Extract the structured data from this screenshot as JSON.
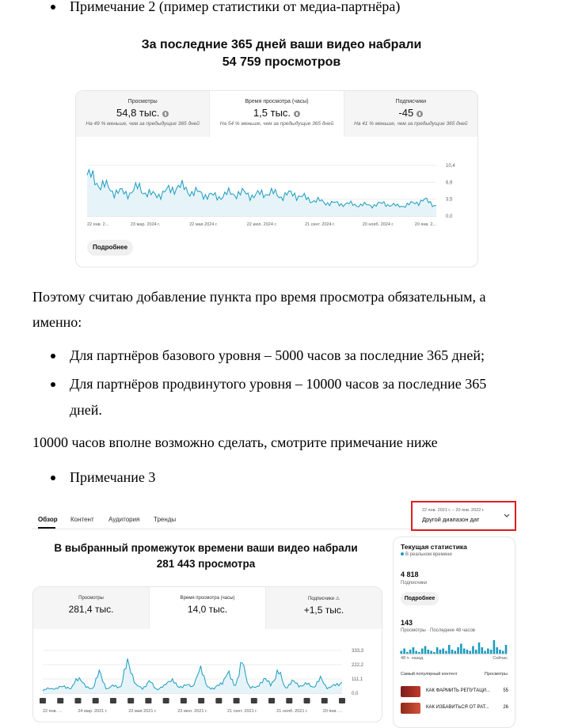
{
  "doc": {
    "note2": "Примечание 2 (пример статистики от медиа-партнёра)",
    "para1_line1": "Поэтому считаю добавление пункта про время просмотра обязательным, а",
    "para1_line2": "именно:",
    "bullet1": "Для партнёров базового уровня – 5000 часов за последние 365 дней;",
    "bullet2_line1": "Для партнёров продвинутого уровня – 10000 часов за последние 365",
    "bullet2_line2": "дней.",
    "para2": "10000 часов вполне возможно сделать, смотрите примечание ниже",
    "note3": "Примечание 3"
  },
  "panel1": {
    "title_line1": "За последние 365 дней ваши видео набрали",
    "title_line2": "54 759 просмотров",
    "tabs": [
      {
        "label": "Просмотры",
        "value": "54,8 тыс.",
        "sub": "На 49 % меньше, чем за предыдущие 365 дней"
      },
      {
        "label": "Время просмотра (часы)",
        "value": "1,5 тыс.",
        "sub": "На 54 % меньше, чем за предыдущие 365 дней"
      },
      {
        "label": "Подписчики",
        "value": "-45",
        "sub": "На 41 % меньше, чем за предыдущие 365 дней"
      }
    ],
    "more_button": "Подробнее"
  },
  "panel2": {
    "nav": [
      "Обзор",
      "Контент",
      "Аудитория",
      "Тренды"
    ],
    "date_range": "22 янв. 2021 г. – 20 янв. 2022 г.",
    "date_option": "Другой диапазон дат",
    "title_line1": "В выбранный промежуток времени ваши видео набрали",
    "title_line2": "281 443 просмотра",
    "tabs": [
      {
        "label": "Просмотры",
        "value": "281,4 тыс."
      },
      {
        "label": "Время просмотра (часы)",
        "value": "14,0 тыс."
      },
      {
        "label": "Подписчики",
        "value": "+1,5 тыс."
      }
    ],
    "realtime": {
      "title": "Текущая статистика",
      "status": "В реальном времени",
      "subs_value": "4 818",
      "subs_label": "Подписчики",
      "more_button": "Подробнее",
      "views_value": "143",
      "views_label": "Просмотры · Последние 48 часов",
      "ago_label": "48 ч. назад",
      "now_label": "Сейчас",
      "top_label": "Самый популярный контент",
      "top_col": "Просмотры",
      "items": [
        {
          "title": "КАК ФАРМИТЬ РЕПУТАЦИ...",
          "views": "55"
        },
        {
          "title": "КАК ИЗБАВИТЬСЯ ОТ РАТ...",
          "views": "26"
        }
      ]
    }
  },
  "chart_data": [
    {
      "type": "line",
      "x": [
        "22 янв. 2...",
        "23 мар. 2024 г.",
        "22 мая 2024 г.",
        "22 июл. 2024 г.",
        "21 сент. 2024 г.",
        "20 нояб. 2024 г.",
        "20 янв. 2..."
      ],
      "y_ticks": [
        "10,4",
        "6,9",
        "3,5",
        "0,0"
      ],
      "ylim": [
        0,
        10.4
      ],
      "values": [
        8.4,
        6.6,
        5.2,
        4.6,
        5.8,
        4.2,
        4.8,
        6.2,
        5.0,
        4.5,
        3.9,
        4.6,
        4.7,
        4.2,
        4.9,
        4.1,
        4.6,
        3.5,
        3.0,
        2.6,
        2.5,
        2.3,
        2.2,
        2.6,
        2.0,
        2.4,
        3.3,
        2.2
      ],
      "color": "#1a9bbf"
    },
    {
      "type": "line",
      "x": [
        "22 янв. ...",
        "24 мар. 2021 г.",
        "23 мая 2021 г.",
        "23 июл. 2021 г.",
        "21 сент. 2021 г.",
        "21 нояб. 2021 г.",
        "20 янв. ..."
      ],
      "y_ticks": [
        "333,3",
        "222,2",
        "111,1",
        "0,0"
      ],
      "ylim": [
        0,
        333.3
      ],
      "values": [
        20,
        40,
        35,
        60,
        30,
        140,
        45,
        40,
        160,
        30,
        60,
        50,
        270,
        60,
        40,
        90,
        30,
        50,
        120,
        40,
        70,
        45,
        200,
        60,
        30,
        80,
        150,
        60,
        230,
        50,
        40,
        120,
        60,
        180,
        40,
        90,
        60,
        70,
        50,
        110,
        40,
        60,
        90
      ],
      "color": "#1a9bbf"
    }
  ]
}
